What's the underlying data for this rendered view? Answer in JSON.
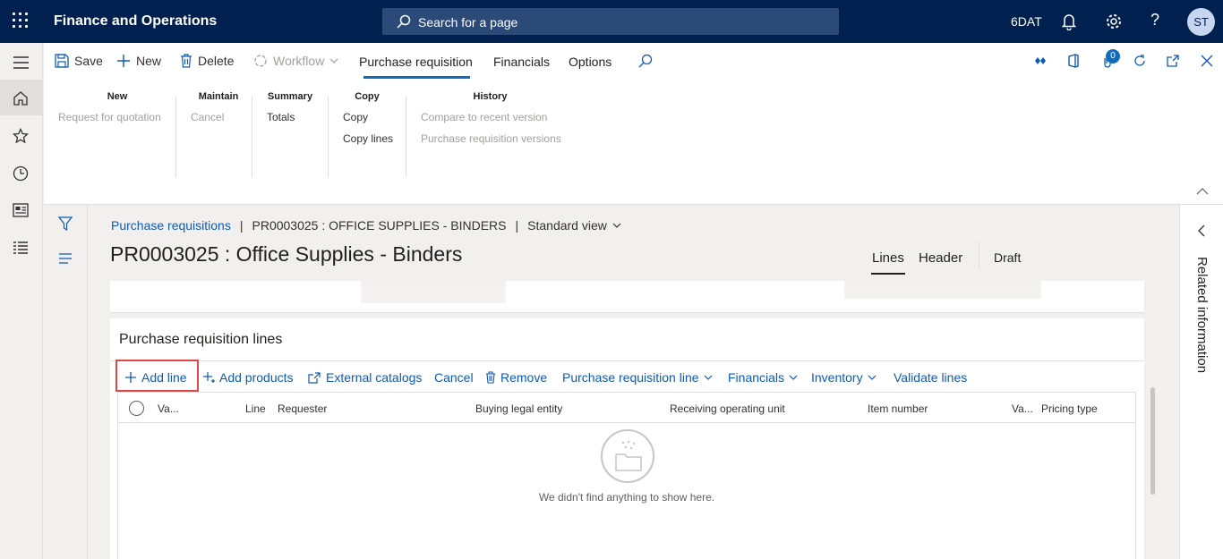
{
  "topbar": {
    "app_title": "Finance and Operations",
    "search_placeholder": "Search for a page",
    "company": "6DAT",
    "avatar_initials": "ST"
  },
  "actions": {
    "save": "Save",
    "new": "New",
    "delete": "Delete",
    "workflow": "Workflow",
    "notification_count": "0"
  },
  "tabs": [
    "Purchase requisition",
    "Financials",
    "Options"
  ],
  "ribbon": {
    "new": {
      "header": "New",
      "items": [
        "Request for quotation"
      ]
    },
    "maintain": {
      "header": "Maintain",
      "items": [
        "Cancel"
      ]
    },
    "summary": {
      "header": "Summary",
      "items": [
        "Totals"
      ]
    },
    "copy": {
      "header": "Copy",
      "items": [
        "Copy",
        "Copy lines"
      ]
    },
    "history": {
      "header": "History",
      "items": [
        "Compare to recent version",
        "Purchase requisition versions"
      ]
    }
  },
  "breadcrumb": {
    "link": "Purchase requisitions",
    "sep": "|",
    "record": "PR0003025 : OFFICE SUPPLIES - BINDERS",
    "view": "Standard view"
  },
  "page_title": "PR0003025 : Office Supplies - Binders",
  "view_tabs": {
    "lines": "Lines",
    "header": "Header"
  },
  "status": "Draft",
  "lines_section": {
    "title": "Purchase requisition lines",
    "buttons": {
      "add_line": "Add line",
      "add_products": "Add products",
      "external_catalogs": "External catalogs",
      "cancel": "Cancel",
      "remove": "Remove",
      "pr_line": "Purchase requisition line",
      "financials": "Financials",
      "inventory": "Inventory",
      "validate": "Validate lines"
    },
    "columns": [
      "Va...",
      "Line",
      "Requester",
      "Buying legal entity",
      "Receiving operating unit",
      "Item number",
      "Va...",
      "Pricing type"
    ],
    "empty_message": "We didn't find anything to show here."
  },
  "related_info": "Related information"
}
